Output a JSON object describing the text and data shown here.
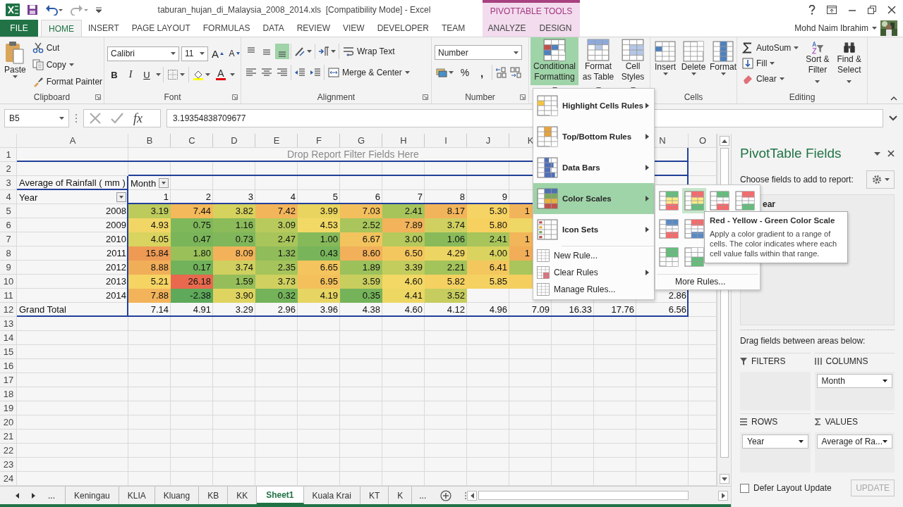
{
  "window": {
    "title": "taburan_hujan_di_Malaysia_2008_2014.xls  [Compatibility Mode] - Excel",
    "context_group": "PIVOTTABLE TOOLS",
    "user": "Mohd Naim Ibrahim"
  },
  "ribbon_tabs": [
    {
      "label": "FILE",
      "kind": "file",
      "selected": false
    },
    {
      "label": "HOME",
      "kind": "main",
      "selected": true
    },
    {
      "label": "INSERT",
      "kind": "main",
      "selected": false
    },
    {
      "label": "PAGE LAYOUT",
      "kind": "main",
      "selected": false
    },
    {
      "label": "FORMULAS",
      "kind": "main",
      "selected": false
    },
    {
      "label": "DATA",
      "kind": "main",
      "selected": false
    },
    {
      "label": "REVIEW",
      "kind": "main",
      "selected": false
    },
    {
      "label": "VIEW",
      "kind": "main",
      "selected": false
    },
    {
      "label": "DEVELOPER",
      "kind": "main",
      "selected": false
    },
    {
      "label": "TEAM",
      "kind": "main",
      "selected": false
    },
    {
      "label": "ANALYZE",
      "kind": "context",
      "selected": false
    },
    {
      "label": "DESIGN",
      "kind": "context",
      "selected": false
    }
  ],
  "ribbon": {
    "clipboard": {
      "label": "Clipboard",
      "paste": "Paste",
      "cut": "Cut",
      "copy": "Copy",
      "format_painter": "Format Painter"
    },
    "font": {
      "label": "Font",
      "font_name": "Calibri",
      "font_size": "11",
      "grow": "A",
      "shrink": "A",
      "bold": "B",
      "italic": "I",
      "underline": "U",
      "font_color": "A"
    },
    "alignment": {
      "label": "Alignment",
      "vertical_align_buttons": [
        {
          "selected": false
        },
        {
          "selected": false
        },
        {
          "selected": true
        }
      ],
      "wrap_text": "Wrap Text",
      "merge_center": "Merge & Center"
    },
    "number": {
      "label": "Number",
      "format": "Number",
      "percent": "%",
      "comma": ","
    },
    "styles": [
      {
        "label": "Conditional Formatting",
        "selected": true
      },
      {
        "label": "Format as Table",
        "selected": false
      },
      {
        "label": "Cell Styles",
        "selected": false
      }
    ],
    "cells": {
      "label": "Cells",
      "buttons": [
        "Insert",
        "Delete",
        "Format"
      ]
    },
    "editing": {
      "label": "Editing",
      "autosum": "AutoSum",
      "fill": "Fill",
      "clear": "Clear",
      "sort_filter": "Sort & Filter",
      "find_select": "Find & Select"
    }
  },
  "formula_bar": {
    "name_box": "B5",
    "fx": "fx",
    "formula": "3.19354838709677"
  },
  "sheet": {
    "column_headers": [
      "A",
      "B",
      "C",
      "D",
      "E",
      "F",
      "G",
      "H",
      "I",
      "J",
      "K",
      "N",
      "O"
    ],
    "row_numbers": [
      "1",
      "2",
      "3",
      "4",
      "5",
      "6",
      "7",
      "8",
      "9",
      "10",
      "11",
      "12",
      "13",
      "14",
      "15",
      "16",
      "17",
      "18",
      "19",
      "20",
      "21",
      "22",
      "23",
      "24"
    ],
    "pivot": {
      "filter_zone": "Drop Report Filter Fields Here",
      "value_label": "Average of Rainfall ( mm )",
      "column_field": "Month",
      "row_field": "Year",
      "months": [
        "1",
        "2",
        "3",
        "4",
        "5",
        "6",
        "7",
        "8",
        "9"
      ],
      "rows": [
        {
          "year": "2008",
          "cells": [
            {
              "text": "3.19",
              "color": "#bccb5c"
            },
            {
              "text": "7.44",
              "color": "#f3b95a"
            },
            {
              "text": "3.82",
              "color": "#d5d25e"
            },
            {
              "text": "7.42",
              "color": "#f3b55a"
            },
            {
              "text": "3.99",
              "color": "#e8d45e"
            },
            {
              "text": "7.03",
              "color": "#f2bf5c"
            },
            {
              "text": "2.41",
              "color": "#a6c45a"
            },
            {
              "text": "8.17",
              "color": "#f2b45a"
            },
            {
              "text": "5.30",
              "color": "#f5d364"
            },
            {
              "text": "1",
              "color": "#f2b45a"
            },
            null,
            null,
            null
          ]
        },
        {
          "year": "2009",
          "cells": [
            {
              "text": "4.93",
              "color": "#f1d665"
            },
            {
              "text": "0.75",
              "color": "#7fb85a"
            },
            {
              "text": "1.16",
              "color": "#8cbb5a"
            },
            {
              "text": "3.09",
              "color": "#b9ca5d"
            },
            {
              "text": "4.53",
              "color": "#f2d965"
            },
            {
              "text": "2.52",
              "color": "#a9c55b"
            },
            {
              "text": "7.89",
              "color": "#f2b35a"
            },
            {
              "text": "3.74",
              "color": "#cfd05f"
            },
            {
              "text": "5.80",
              "color": "#f6d15f"
            },
            {
              "color": "#efd766"
            },
            null,
            null,
            null
          ]
        },
        {
          "year": "2010",
          "cells": [
            {
              "text": "4.05",
              "color": "#d9d35f"
            },
            {
              "text": "0.47",
              "color": "#7ab55a"
            },
            {
              "text": "0.73",
              "color": "#80b75a"
            },
            {
              "text": "2.47",
              "color": "#a8c55b"
            },
            {
              "text": "1.00",
              "color": "#86b95a"
            },
            {
              "text": "6.67",
              "color": "#f3c45e"
            },
            {
              "text": "3.00",
              "color": "#b5c95c"
            },
            {
              "text": "1.06",
              "color": "#88ba5a"
            },
            {
              "text": "2.41",
              "color": "#a7c55b"
            },
            {
              "text": "1",
              "color": "#f2b55a"
            },
            null,
            null,
            null
          ]
        },
        {
          "year": "2011",
          "cells": [
            {
              "text": "15.84",
              "color": "#ee9a55"
            },
            {
              "text": "1.80",
              "color": "#9ac05a"
            },
            {
              "text": "8.09",
              "color": "#f3b25a"
            },
            {
              "text": "1.32",
              "color": "#90bc5a"
            },
            {
              "text": "0.43",
              "color": "#78b55a"
            },
            {
              "text": "8.60",
              "color": "#f2b05a"
            },
            {
              "text": "6.50",
              "color": "#f4c75e"
            },
            {
              "text": "4.29",
              "color": "#ecd563"
            },
            {
              "text": "4.00",
              "color": "#dad35f"
            },
            {
              "text": "1",
              "color": "#f1ad58"
            },
            null,
            null,
            null
          ]
        },
        {
          "year": "2012",
          "cells": [
            {
              "text": "8.88",
              "color": "#f1ae59"
            },
            {
              "text": "0.17",
              "color": "#71b25a"
            },
            {
              "text": "3.74",
              "color": "#cfd05f"
            },
            {
              "text": "2.35",
              "color": "#a5c45b"
            },
            {
              "text": "6.65",
              "color": "#f4c45e"
            },
            {
              "text": "1.89",
              "color": "#9cc15b"
            },
            {
              "text": "3.39",
              "color": "#c3cd5e"
            },
            {
              "text": "2.21",
              "color": "#a3c35b"
            },
            {
              "text": "6.41",
              "color": "#f4c75e"
            },
            {
              "color": "#a9c55b"
            },
            null,
            null,
            null
          ]
        },
        {
          "year": "2013",
          "cells": [
            {
              "text": "5.21",
              "color": "#f5d464"
            },
            {
              "text": "26.18",
              "color": "#e8694e"
            },
            {
              "text": "1.59",
              "color": "#95be5a"
            },
            {
              "text": "3.73",
              "color": "#cfd05f"
            },
            {
              "text": "6.95",
              "color": "#f3c05c"
            },
            {
              "text": "3.59",
              "color": "#c8ce5e"
            },
            {
              "text": "4.60",
              "color": "#f3d865"
            },
            {
              "text": "5.82",
              "color": "#f4d161"
            },
            {
              "text": "5.85",
              "color": "#f4d161"
            },
            {
              "color": "#f4cf60"
            },
            null,
            null,
            null
          ]
        },
        {
          "year": "2014",
          "cells": [
            {
              "text": "7.88",
              "color": "#f2b35a"
            },
            {
              "text": "-2.38",
              "color": "#5ea95a"
            },
            {
              "text": "3.90",
              "color": "#e0d460"
            },
            {
              "text": "0.32",
              "color": "#74b35a"
            },
            {
              "text": "4.19",
              "color": "#e6d562"
            },
            {
              "text": "0.35",
              "color": "#75b35a"
            },
            {
              "text": "4.41",
              "color": "#ecd763"
            },
            {
              "text": "3.52",
              "color": "#c6cd5e"
            },
            null,
            null,
            null,
            null,
            {
              "text": "2.86"
            }
          ]
        }
      ],
      "grand_total": {
        "label": "Grand Total",
        "values": [
          "7.14",
          "4.91",
          "3.29",
          "2.96",
          "3.96",
          "4.38",
          "4.60",
          "4.12",
          "4.96",
          "7.09",
          "16.33",
          "17.76",
          "6.56"
        ]
      }
    }
  },
  "sheet_tabs": {
    "overflow_left": "...",
    "overflow_right": "...",
    "tabs": [
      {
        "label": "Keningau",
        "selected": false
      },
      {
        "label": "KLIA",
        "selected": false
      },
      {
        "label": "Kluang",
        "selected": false
      },
      {
        "label": "KB",
        "selected": false
      },
      {
        "label": "KK",
        "selected": false
      },
      {
        "label": "Sheet1",
        "selected": true
      },
      {
        "label": "Kuala Krai",
        "selected": false
      },
      {
        "label": "KT",
        "selected": false
      },
      {
        "label": "K",
        "selected": false
      }
    ]
  },
  "pivot_panel": {
    "title": "PivotTable Fields",
    "subtitle": "Choose fields to add to report:",
    "fields": [
      "ear"
    ],
    "areas_hint": "Drag fields between areas below:",
    "areas": [
      {
        "kind": "filters",
        "label": "FILTERS"
      },
      {
        "kind": "columns",
        "label": "COLUMNS",
        "items": [
          "Month"
        ]
      },
      {
        "kind": "rows",
        "label": "ROWS",
        "items": [
          "Year"
        ]
      },
      {
        "kind": "values",
        "label": "VALUES",
        "items": [
          "Average of Ra..."
        ]
      }
    ],
    "defer": {
      "label": "Defer Layout Update",
      "checked": false
    },
    "update_button": {
      "label": "UPDATE",
      "disabled": true
    }
  },
  "conditional_formatting_menu": {
    "items": [
      {
        "label": "Highlight Cells Rules",
        "kind": "large",
        "submenu": true,
        "selected": false
      },
      {
        "label": "Top/Bottom Rules",
        "kind": "large",
        "submenu": true,
        "selected": false
      },
      {
        "label": "Data Bars",
        "kind": "large",
        "submenu": true,
        "selected": false
      },
      {
        "label": "Color Scales",
        "kind": "large",
        "submenu": true,
        "selected": true
      },
      {
        "label": "Icon Sets",
        "kind": "large",
        "submenu": true,
        "selected": false
      },
      {
        "label": "New Rule...",
        "kind": "small",
        "submenu": false,
        "selected": false
      },
      {
        "label": "Clear Rules",
        "kind": "small",
        "submenu": true,
        "selected": false
      },
      {
        "label": "Manage Rules...",
        "kind": "small",
        "submenu": false,
        "selected": false
      }
    ],
    "color_scales": [
      [
        {
          "selected": false
        },
        {
          "selected": true
        },
        {
          "selected": false
        },
        {
          "selected": false
        }
      ],
      [
        {
          "selected": false
        },
        {
          "selected": false
        }
      ],
      [
        {
          "selected": false
        },
        {
          "selected": false
        }
      ]
    ],
    "more_rules": "More Rules...",
    "tooltip": {
      "title": "Red - Yellow - Green Color Scale",
      "text": "Apply a color gradient to a range of cells. The color indicates where each cell value falls within that range."
    }
  }
}
